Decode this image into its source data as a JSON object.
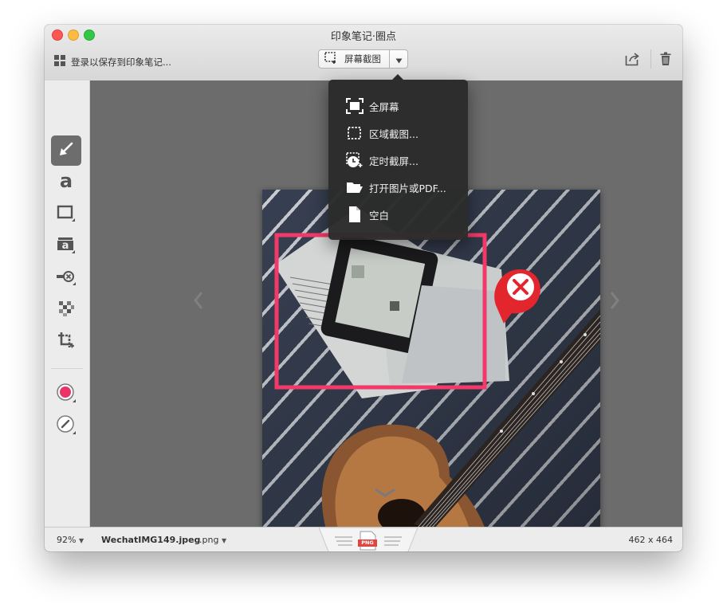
{
  "window": {
    "title": "印象笔记·圈点"
  },
  "toolbar": {
    "login_label": "登录以保存到印象笔记...",
    "capture_label": "屏幕截图",
    "share_icon": "share-icon",
    "trash_icon": "trash-icon"
  },
  "capture_menu": {
    "items": [
      {
        "label": "全屏幕",
        "icon": "fullscreen-icon"
      },
      {
        "label": "区域截图...",
        "icon": "region-capture-icon"
      },
      {
        "label": "定时截屏...",
        "icon": "timer-capture-icon"
      },
      {
        "label": "打开图片或PDF...",
        "icon": "folder-open-icon"
      },
      {
        "label": "空白",
        "icon": "blank-document-icon"
      }
    ]
  },
  "tools": [
    {
      "name": "arrow-tool",
      "active": true
    },
    {
      "name": "text-tool"
    },
    {
      "name": "rectangle-tool"
    },
    {
      "name": "stamp-text-tool"
    },
    {
      "name": "highlighter-tool"
    },
    {
      "name": "pixelate-tool"
    },
    {
      "name": "crop-tool"
    },
    {
      "name": "color-picker",
      "color": "#ea3468"
    },
    {
      "name": "line-width-picker"
    }
  ],
  "annotations": {
    "rect_color": "#f23a6a",
    "stamp_color": "#e3262e"
  },
  "status": {
    "zoom": "92%",
    "filename": "WechatIMG149.jpeg",
    "format": ".png",
    "dimensions": "462 x 464",
    "save_badge": "PNG"
  }
}
